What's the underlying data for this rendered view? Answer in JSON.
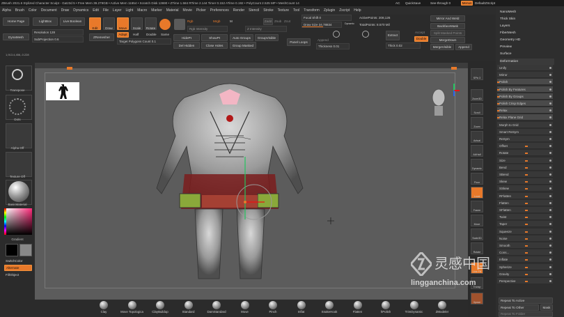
{
  "titlebar": {
    "title": "ZBrush 2021.6   Stylized Character Sculpt - Gatz3d 5   • Free Mem 39.279GB • Active Mem 11654 • Scratch Disk 13690 • ZTime 1.584 RTime 2.144 Timer 0.152 ATime 0.192 • PolyCount 2.525 MP • MeshCount 14",
    "ac": "AC",
    "quicksave": "QuickSave",
    "seethrough": "See-through  0",
    "menus": "Menus",
    "defaultzscript": "DefaultZScript"
  },
  "menubar": [
    "Alpha",
    "Brush",
    "Color",
    "Document",
    "Draw",
    "Dynamics",
    "Edit",
    "File",
    "Layer",
    "Light",
    "Macro",
    "Marker",
    "Material",
    "Movie",
    "Picker",
    "Preferences",
    "Render",
    "Stencil",
    "Stroke",
    "Texture",
    "Tool",
    "Transform",
    "Zplugin",
    "Zscript",
    "Help"
  ],
  "toolbar": {
    "home_page": "Home Page",
    "lightbox": "LightBox",
    "live_boolean": "Live Boolean",
    "dynamesh": "DynaMesh",
    "resolution": "Resolution 128",
    "subprojection": "SubProjection 0.6",
    "edit": "Edit",
    "draw": "Draw",
    "move": "Move",
    "scale": "Scale",
    "rotate": "Rotate",
    "zremesher": "ZRemesher",
    "adapt": "Adapt",
    "half": "Half",
    "double": "Double",
    "same": "Same",
    "target_polygons": "Target Polygons Count  0.1",
    "hidept": "HidePt",
    "del_hidden": "Del Hidden",
    "showpt": "ShowPt",
    "close_holes": "Close Holes",
    "auto_groups": "Auto Groups",
    "group_visible": "GroupVisible",
    "group_masked": "Group Masked",
    "rgb": "Rgb",
    "m": "M",
    "mrgb": "Mrgb",
    "zadd": "Zadd",
    "zsub": "Zsub",
    "zcut": "Zcut",
    "rgb_intensity": "Rgb Intensity",
    "z_intensity": "Z Intensity",
    "focal_shift": "Focal Shift 0",
    "draw_size": "Draw Size 34.78834",
    "dynamic": "Dynamic",
    "active_points": "ActivePoints: 208,126",
    "total_points": "TotalPoints: 8.570 Mil",
    "panel_loops": "Panel Loops",
    "append": "Append",
    "thickness": "Thickness 0.01",
    "extract": "Extract",
    "accept": "Accept",
    "double2": "Double",
    "thick": "Thick 0.02",
    "mirror_and_weld": "Mirror And Weld",
    "backface_mask": "BackfaceMask",
    "split_masked": "Split Masked Points",
    "merge_down": "MergeDown",
    "merge_visible": "MergeVisible",
    "append2": "Append"
  },
  "left_tray": {
    "transpose": "Transpose",
    "dots": "Dots",
    "alpha_off": "Alpha Off",
    "texture_off": "Texture Off",
    "basic_material": "BasicMaterial",
    "gradient": "Gradient",
    "switch_color": "SwitchColor",
    "alternate": "Alternate",
    "fill_object": "FillObject",
    "coords": "1,913.4,456,-0.228"
  },
  "right_shelf": [
    "SPix 3",
    "Zoom3D",
    "Scroll",
    "Zoom",
    "Actual",
    "AAHalf",
    "Dynamic Persp",
    "Floor",
    "Local",
    "Frame",
    "Move",
    "Scale3D",
    "Rotate",
    "Line Fill PolyF",
    "Transp",
    "Ghost",
    "Solo",
    "Xpose"
  ],
  "right_tray": {
    "top_items": [
      "NanoMesh",
      "Thick Skin",
      "Layers",
      "FiberMesh",
      "Geometry HD",
      "Preview",
      "Surface",
      "Deformation"
    ],
    "sliders": [
      "Unify",
      "Mirror",
      "Polish",
      "Polish By Features",
      "Polish By Groups",
      "Polish Crisp Edges",
      "Relax",
      "Relax Plane Grid",
      "Morph to Grid",
      "Smart ReSym",
      "ReSym",
      "Offset",
      "Rotate",
      "Size",
      "Bend",
      "SBend",
      "Skew",
      "SSkew",
      "RFlatten",
      "Flatten",
      "SFlatten",
      "Twist",
      "Taper",
      "Squeeze",
      "Noise",
      "Smooth",
      "Cons...",
      "Inflate",
      "Spherize",
      "Gravity",
      "Perspective"
    ],
    "repeat_to_active": "Repeat To Active",
    "repeat_to_other": "Repeat To Other",
    "mask": "Mask",
    "repeat_to_folder": "Repeat To Folder"
  },
  "brushes": [
    "Clay",
    "Move Topologica",
    "ClayBuildup",
    "Standard",
    "DamStandard",
    "Move",
    "Pinch",
    "Inflat",
    "SnakeHook",
    "Flatten",
    "hPolish",
    "TrimDynamic",
    "ZModeler"
  ],
  "watermark": {
    "cn": "灵感中国",
    "url": "lingganchina.com"
  },
  "colors": {
    "accent": "#e8792a",
    "canvas": "#5c5c5c",
    "panel": "#2e2e2e"
  }
}
